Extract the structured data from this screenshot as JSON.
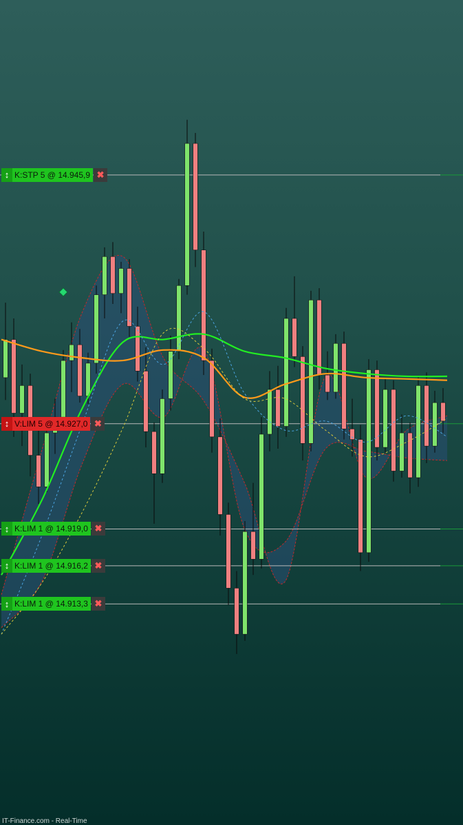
{
  "footer": {
    "source_label": "IT-Finance.com - Real-Time"
  },
  "orders": [
    {
      "label": "K:STP  5 @ 14.945,9",
      "price": 14945.9,
      "side": "buy",
      "arrow_icon": "double-arrow-icon",
      "close_icon": "close-x-icon"
    },
    {
      "label": "V:LIM  5 @ 14.927,0",
      "price": 14927.0,
      "side": "sell",
      "arrow_icon": "double-arrow-icon",
      "close_icon": "close-x-icon"
    },
    {
      "label": "K:LIM  1 @ 14.919,0",
      "price": 14919.0,
      "side": "buy",
      "arrow_icon": "double-arrow-icon",
      "close_icon": "close-x-icon"
    },
    {
      "label": "K:LIM  1 @ 14.916,2",
      "price": 14916.2,
      "side": "buy",
      "arrow_icon": "double-arrow-icon",
      "close_icon": "close-x-icon"
    },
    {
      "label": "K:LIM  1 @ 14.913,3",
      "price": 14913.3,
      "side": "buy",
      "arrow_icon": "double-arrow-icon",
      "close_icon": "close-x-icon"
    }
  ],
  "colors": {
    "buy_tag": "#1fc41f",
    "sell_tag": "#e02828",
    "up_candle": "#7fe36b",
    "down_candle": "#f08080",
    "wick": "#0a0a0a",
    "ma_green": "#22ee22",
    "ma_orange": "#ff9a1a",
    "band_fill": "#2a4f75",
    "band_edge": "#c02a2a",
    "dotted_blue": "#4aa3e0",
    "dotted_yellow": "#d8c83a",
    "order_line": "#b9b9b9",
    "signal_marker": "#25d870"
  },
  "chart_data": {
    "type": "candlestick",
    "instrument_scale": "price",
    "ylim": [
      14896.5,
      14959.2
    ],
    "candles": [
      [
        14930.5,
        14936.2,
        14928.8,
        14933.4
      ],
      [
        14933.4,
        14935.0,
        14926.0,
        14927.8
      ],
      [
        14927.8,
        14931.5,
        14925.3,
        14929.9
      ],
      [
        14929.9,
        14930.8,
        14923.0,
        14924.6
      ],
      [
        14924.6,
        14926.5,
        14920.9,
        14922.2
      ],
      [
        14922.2,
        14927.0,
        14921.8,
        14926.3
      ],
      [
        14926.3,
        14928.9,
        14924.7,
        14927.5
      ],
      [
        14927.5,
        14932.6,
        14926.9,
        14931.8
      ],
      [
        14931.8,
        14934.7,
        14929.4,
        14933.0
      ],
      [
        14933.0,
        14934.2,
        14928.6,
        14929.1
      ],
      [
        14929.1,
        14932.4,
        14928.5,
        14931.6
      ],
      [
        14931.6,
        14937.5,
        14930.8,
        14936.8
      ],
      [
        14936.8,
        14940.4,
        14935.0,
        14939.7
      ],
      [
        14939.7,
        14940.8,
        14936.1,
        14936.9
      ],
      [
        14936.9,
        14939.3,
        14935.4,
        14938.8
      ],
      [
        14938.8,
        14939.5,
        14933.6,
        14934.4
      ],
      [
        14934.4,
        14935.9,
        14930.2,
        14931.0
      ],
      [
        14931.0,
        14932.8,
        14925.2,
        14926.4
      ],
      [
        14926.4,
        14927.1,
        14919.4,
        14923.2
      ],
      [
        14923.2,
        14929.6,
        14922.5,
        14928.9
      ],
      [
        14928.9,
        14933.7,
        14928.0,
        14932.5
      ],
      [
        14932.5,
        14938.0,
        14931.9,
        14937.5
      ],
      [
        14937.5,
        14950.1,
        14936.8,
        14948.3
      ],
      [
        14948.3,
        14949.1,
        14938.9,
        14940.2
      ],
      [
        14940.2,
        14941.6,
        14930.7,
        14931.8
      ],
      [
        14931.8,
        14932.7,
        14924.8,
        14926.0
      ],
      [
        14926.0,
        14927.4,
        14918.5,
        14920.1
      ],
      [
        14920.1,
        14921.0,
        14913.2,
        14914.5
      ],
      [
        14914.5,
        14915.8,
        14909.5,
        14911.0
      ],
      [
        14911.0,
        14919.6,
        14910.5,
        14918.8
      ],
      [
        14918.8,
        14922.5,
        14915.5,
        14916.7
      ],
      [
        14916.7,
        14927.5,
        14916.0,
        14926.2
      ],
      [
        14926.2,
        14931.0,
        14924.9,
        14929.6
      ],
      [
        14929.6,
        14931.4,
        14925.1,
        14926.8
      ],
      [
        14926.8,
        14935.8,
        14926.0,
        14935.0
      ],
      [
        14935.0,
        14938.2,
        14931.3,
        14932.1
      ],
      [
        14932.1,
        14932.9,
        14924.2,
        14925.5
      ],
      [
        14925.5,
        14937.1,
        14924.9,
        14936.4
      ],
      [
        14936.4,
        14937.3,
        14929.6,
        14930.7
      ],
      [
        14930.7,
        14932.5,
        14928.8,
        14929.4
      ],
      [
        14929.4,
        14933.8,
        14928.9,
        14933.1
      ],
      [
        14933.1,
        14934.0,
        14925.8,
        14926.6
      ],
      [
        14926.6,
        14928.9,
        14924.5,
        14925.8
      ],
      [
        14925.8,
        14926.9,
        14915.8,
        14917.2
      ],
      [
        14917.2,
        14931.9,
        14916.5,
        14931.1
      ],
      [
        14931.1,
        14931.8,
        14924.2,
        14925.2
      ],
      [
        14925.2,
        14930.4,
        14924.8,
        14929.6
      ],
      [
        14929.6,
        14930.3,
        14922.6,
        14923.4
      ],
      [
        14923.4,
        14927.7,
        14922.9,
        14926.3
      ],
      [
        14926.3,
        14927.1,
        14921.7,
        14922.9
      ],
      [
        14922.9,
        14930.6,
        14922.2,
        14929.9
      ],
      [
        14929.9,
        14930.9,
        14924.0,
        14925.3
      ],
      [
        14925.3,
        14929.5,
        14924.8,
        14928.6
      ],
      [
        14928.6,
        14929.7,
        14926.3,
        14927.2
      ]
    ],
    "moving_averages": [
      {
        "name": "",
        "color": "#22ee22",
        "style": "solid",
        "values": [
          14915.5,
          14921.2,
          14928.2,
          14933.2,
          14933.4,
          14933.8,
          14932.5,
          14932.0,
          14931.2,
          14930.8,
          14930.6,
          14930.6
        ]
      },
      {
        "name": "",
        "color": "#ff9a1a",
        "style": "solid",
        "values": [
          14933.4,
          14932.5,
          14932.0,
          14931.8,
          14932.6,
          14932.0,
          14929.0,
          14930.0,
          14930.8,
          14930.5,
          14930.4,
          14930.3
        ]
      },
      {
        "name": "",
        "color": "#4aa3e0",
        "style": "dashed",
        "values": [
          14911.0,
          14918.5,
          14927.0,
          14934.8,
          14931.5,
          14935.5,
          14929.3,
          14926.5,
          14927.2,
          14925.6,
          14927.6,
          14926.0
        ]
      },
      {
        "name": "",
        "color": "#d8c83a",
        "style": "dashed",
        "values": [
          14911.0,
          14914.9,
          14920.3,
          14926.7,
          14933.9,
          14932.7,
          14928.9,
          14928.9,
          14926.5,
          14924.5,
          14925.6,
          14927.4
        ]
      }
    ],
    "band": {
      "upper": [
        14914.0,
        14925.0,
        14935.5,
        14939.7,
        14932.0,
        14928.7,
        14922.5,
        14915.0,
        14930.6,
        14922.9,
        14926.5,
        14927.6
      ],
      "lower": [
        14911.5,
        14915.0,
        14924.0,
        14930.0,
        14927.5,
        14932.6,
        14919.0,
        14918.0,
        14925.1,
        14924.9,
        14924.4,
        14924.2
      ]
    },
    "signal_markers": [
      {
        "type": "diamond",
        "candle_index": 7,
        "price": 14937.0
      }
    ],
    "grid": false,
    "legend": "none"
  }
}
